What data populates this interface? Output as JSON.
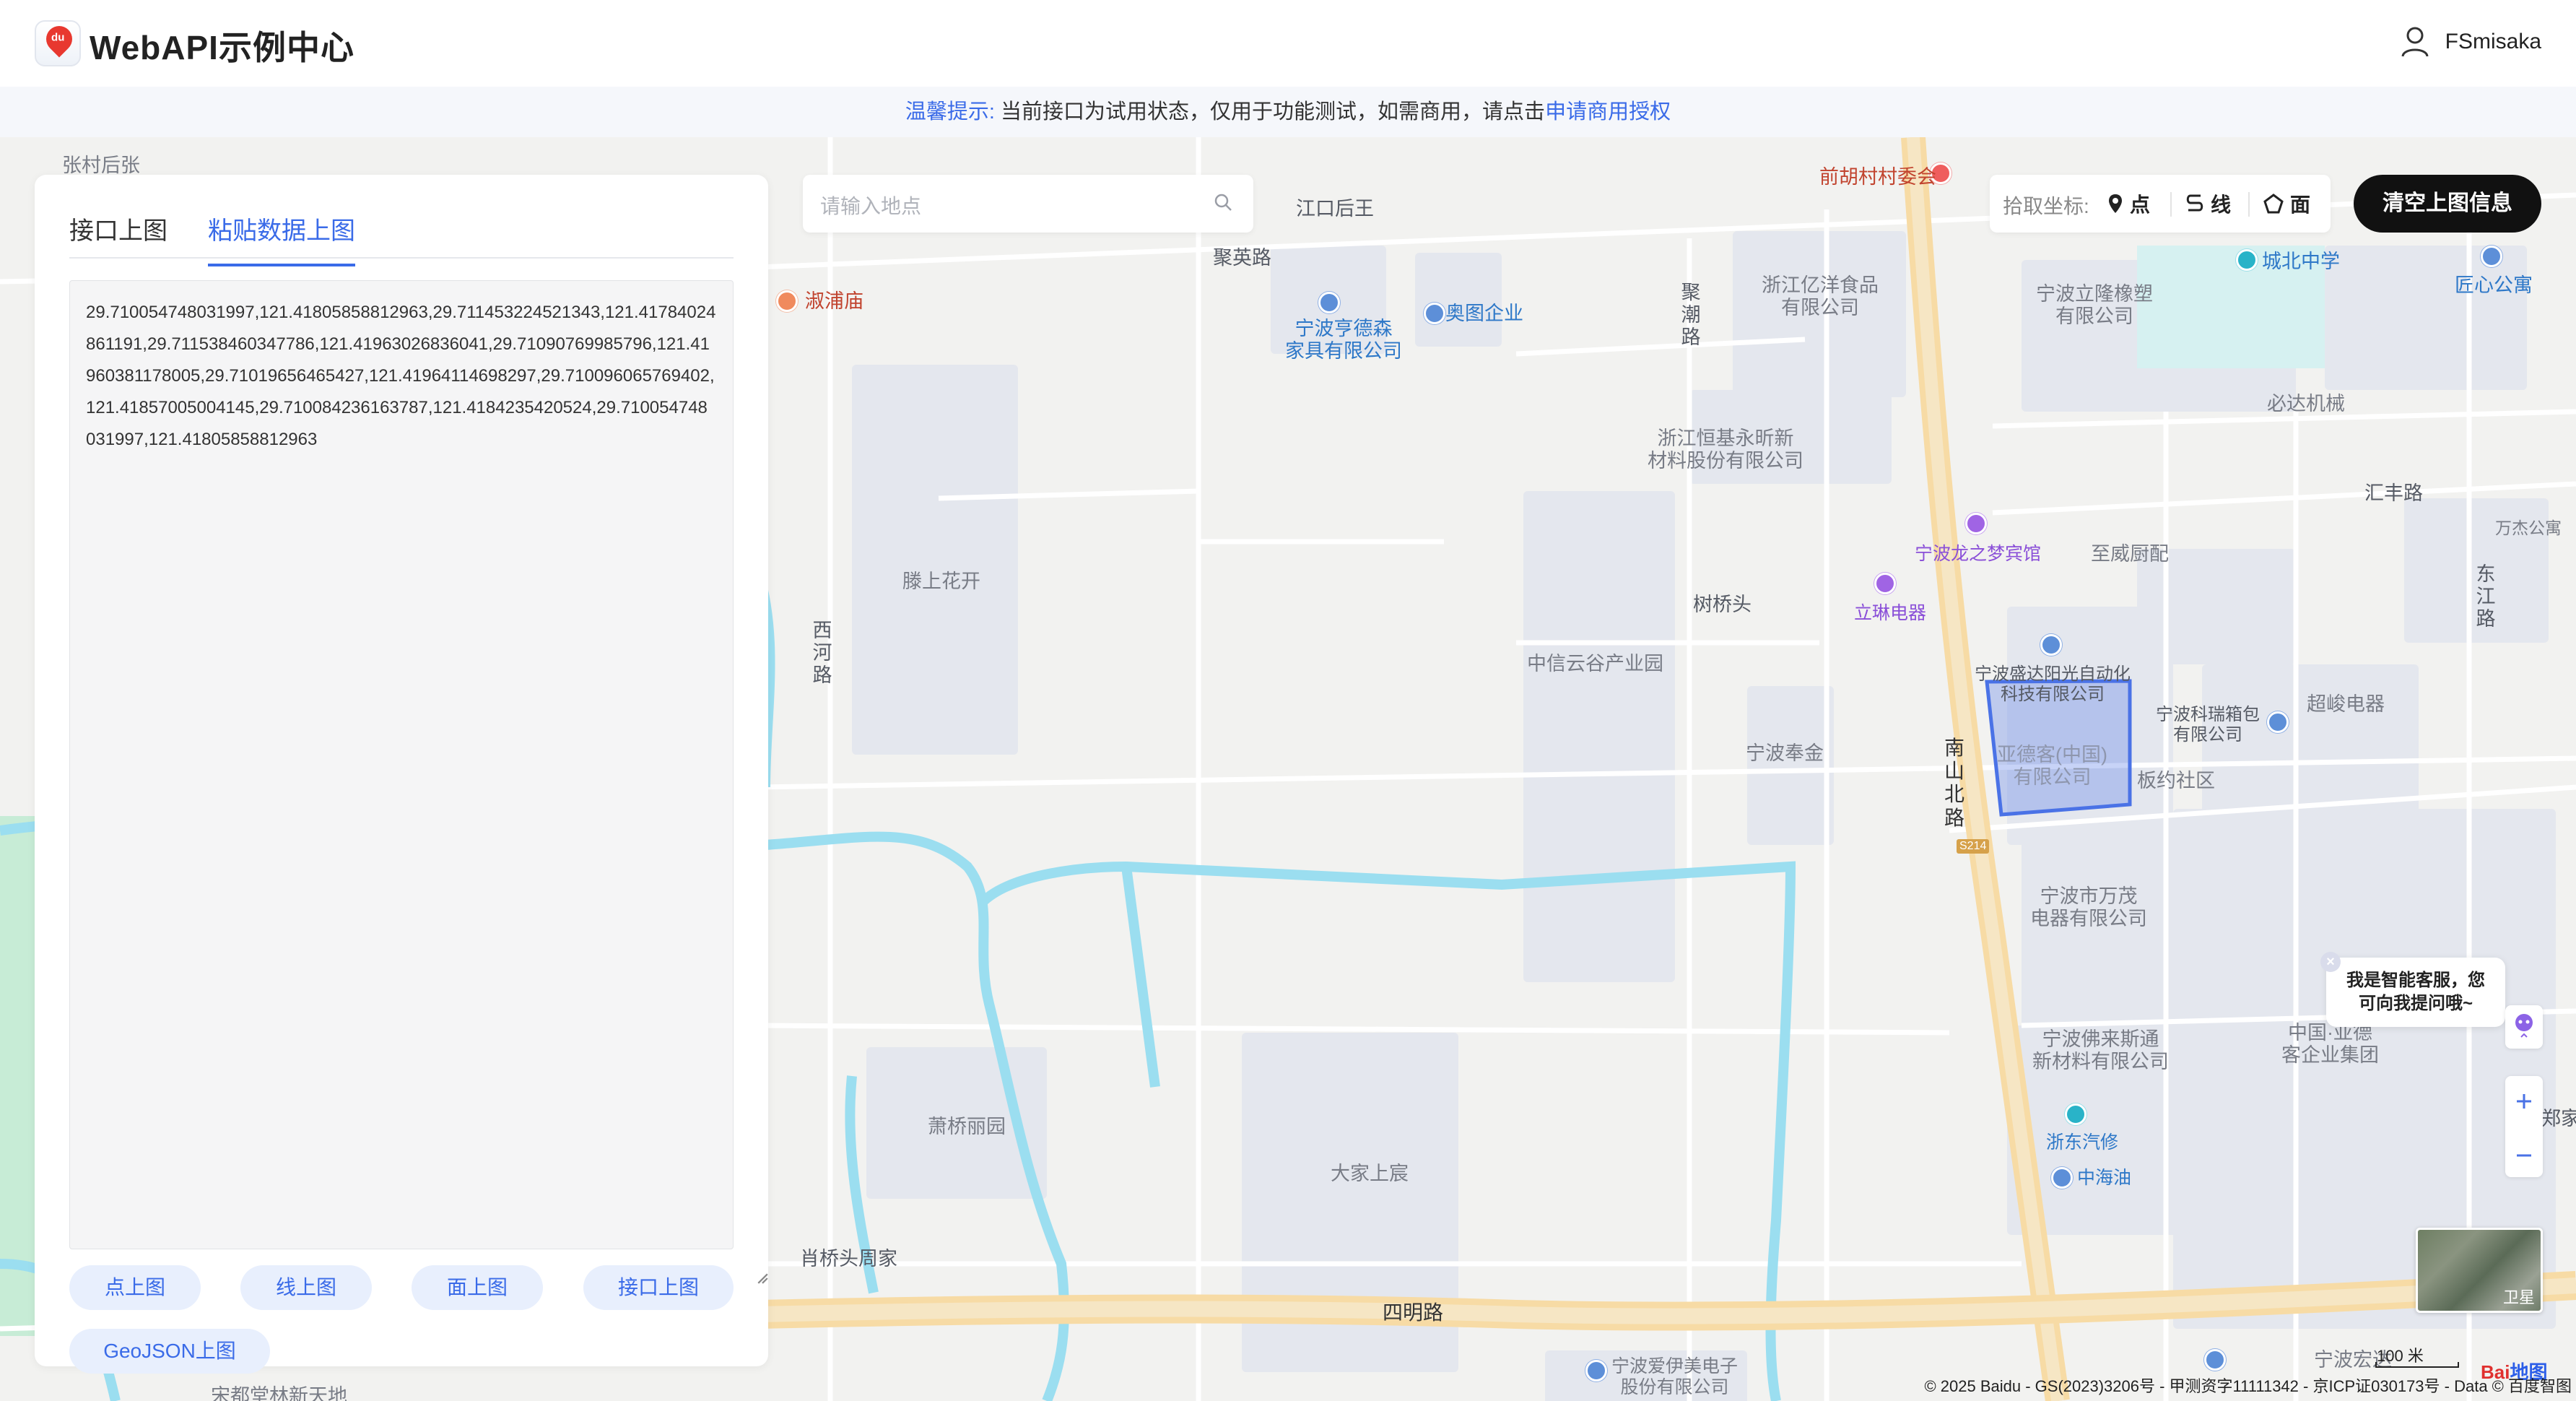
{
  "header": {
    "logo_badge": "du",
    "title": "WebAPI示例中心",
    "username": "FSmisaka"
  },
  "notice": {
    "prefix": "温馨提示:",
    "text": "当前接口为试用状态，仅用于功能测试，如需商用，请点击",
    "link": "申请商用授权"
  },
  "panel": {
    "tabs": [
      "接口上图",
      "粘贴数据上图"
    ],
    "active_tab": 1,
    "textarea_value": "29.710054748031997,121.41805858812963,29.711453224521343,121.41784024861191,29.711538460347786,121.41963026836041,29.71090769985796,121.41960381178005,29.71019656465427,121.41964114698297,29.710096065769402,121.41857005004145,29.710084236163787,121.4184235420524,29.710054748031997,121.41805858812963",
    "buttons": [
      "点上图",
      "线上图",
      "面上图",
      "接口上图",
      "GeoJSON上图"
    ]
  },
  "search": {
    "placeholder": "请输入地点"
  },
  "picker": {
    "label": "拾取坐标:",
    "point": "点",
    "line": "线",
    "polygon": "面"
  },
  "clear_button": "清空上图信息",
  "assistant_bubble": {
    "line1": "我是智能客服，您",
    "line2": "可向我提问哦~"
  },
  "satellite_label": "卫星",
  "scale_label": "100 米",
  "copyright": "© 2025 Baidu - GS(2023)3206号 - 甲测资字11111342 - 京ICP证030173号 - Data © 百度智图",
  "baidu_logo": {
    "part1": "Bai",
    "part2": "地图"
  },
  "map_labels": {
    "zhangcun": "张村后张",
    "jiangkou": "江口后王",
    "jiuying": "聚英路",
    "qianhu": "前胡村村委会",
    "dianpu": "淑浦庙",
    "hengde": "宁波亨德森\n家具有限公司",
    "aotu": "奥图企业",
    "juchao": "聚潮路",
    "yiyang": "浙江亿洋食品\n有限公司",
    "lilong": "宁波立隆橡塑\n有限公司",
    "chengbei": "城北中学",
    "jianggong": "匠心公寓",
    "bida": "必达机械",
    "hengji": "浙江恒基永昕新\n材料股份有限公司",
    "huifeng": "汇丰路",
    "wanjie": "万杰公寓",
    "dongjiang": "东江路",
    "longzhimeng": "宁波龙之梦宾馆",
    "zhiwei": "至威厨配",
    "tengshang": "滕上花开",
    "xihe": "西河路",
    "shuqiao": "树桥头",
    "linlin": "立琳电器",
    "zhongxin": "中信云谷产业园",
    "shengda": "宁波盛达阳光自动化\n科技有限公司",
    "kerui": "宁波科瑞箱包\n有限公司",
    "chaojun": "超峻电器",
    "nanshan": "南山北路",
    "fengjin": "宁波奉金",
    "yadeke": "亚德客(中国)\n有限公司",
    "banyue": "板约社区",
    "s214": "S214",
    "wanmao": "宁波市万茂\n电器有限公司",
    "folaisi": "宁波佛来斯通\n新材料有限公司",
    "zhongguo": "中国·亚德\n客企业集团",
    "xiaoqiao": "萧桥丽园",
    "dajia": "大家上宸",
    "zhedong": "浙东汽修",
    "zhonghaiyou": "中海油",
    "zhengjia": "郑家",
    "xiaoqiaotou": "肖桥头周家",
    "siming": "四明路",
    "aiyimei": "宁波爱伊美电子\n股份有限公司",
    "ningbohong": "宁波宏达",
    "songdu": "宋都堂林新天地"
  }
}
